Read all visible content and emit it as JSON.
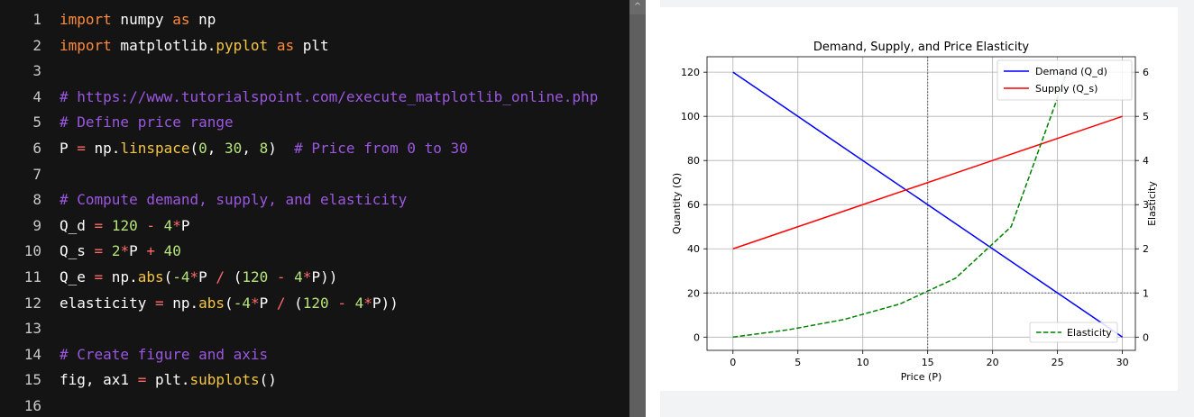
{
  "editor": {
    "lines": [
      {
        "n": "1",
        "tokens": [
          {
            "t": "import",
            "c": "tok-kw"
          },
          {
            "t": " numpy ",
            "c": "tok-id"
          },
          {
            "t": "as",
            "c": "tok-kw"
          },
          {
            "t": " np",
            "c": "tok-id"
          }
        ]
      },
      {
        "n": "2",
        "tokens": [
          {
            "t": "import",
            "c": "tok-kw"
          },
          {
            "t": " matplotlib.",
            "c": "tok-id"
          },
          {
            "t": "pyplot",
            "c": "tok-fn"
          },
          {
            "t": " ",
            "c": "tok-id"
          },
          {
            "t": "as",
            "c": "tok-kw"
          },
          {
            "t": " plt",
            "c": "tok-id"
          }
        ]
      },
      {
        "n": "3",
        "tokens": []
      },
      {
        "n": "4",
        "tokens": [
          {
            "t": "# https://www.tutorialspoint.com/execute_matplotlib_online.php",
            "c": "tok-cm"
          }
        ]
      },
      {
        "n": "5",
        "tokens": [
          {
            "t": "# Define price range",
            "c": "tok-cm"
          }
        ]
      },
      {
        "n": "6",
        "tokens": [
          {
            "t": "P ",
            "c": "tok-id"
          },
          {
            "t": "=",
            "c": "tok-op"
          },
          {
            "t": " np.",
            "c": "tok-id"
          },
          {
            "t": "linspace",
            "c": "tok-fn"
          },
          {
            "t": "(",
            "c": "tok-id"
          },
          {
            "t": "0",
            "c": "tok-num"
          },
          {
            "t": ", ",
            "c": "tok-id"
          },
          {
            "t": "30",
            "c": "tok-num"
          },
          {
            "t": ", ",
            "c": "tok-id"
          },
          {
            "t": "8",
            "c": "tok-num"
          },
          {
            "t": ")  ",
            "c": "tok-id"
          },
          {
            "t": "# Price from 0 to 30",
            "c": "tok-cm"
          }
        ]
      },
      {
        "n": "7",
        "tokens": []
      },
      {
        "n": "8",
        "tokens": [
          {
            "t": "# Compute demand, supply, and elasticity",
            "c": "tok-cm"
          }
        ]
      },
      {
        "n": "9",
        "tokens": [
          {
            "t": "Q_d ",
            "c": "tok-id"
          },
          {
            "t": "=",
            "c": "tok-op"
          },
          {
            "t": " ",
            "c": "tok-id"
          },
          {
            "t": "120",
            "c": "tok-num"
          },
          {
            "t": " ",
            "c": "tok-id"
          },
          {
            "t": "-",
            "c": "tok-op"
          },
          {
            "t": " ",
            "c": "tok-id"
          },
          {
            "t": "4",
            "c": "tok-num"
          },
          {
            "t": "*",
            "c": "tok-op"
          },
          {
            "t": "P",
            "c": "tok-id"
          }
        ]
      },
      {
        "n": "10",
        "tokens": [
          {
            "t": "Q_s ",
            "c": "tok-id"
          },
          {
            "t": "=",
            "c": "tok-op"
          },
          {
            "t": " ",
            "c": "tok-id"
          },
          {
            "t": "2",
            "c": "tok-num"
          },
          {
            "t": "*",
            "c": "tok-op"
          },
          {
            "t": "P ",
            "c": "tok-id"
          },
          {
            "t": "+",
            "c": "tok-op"
          },
          {
            "t": " ",
            "c": "tok-id"
          },
          {
            "t": "40",
            "c": "tok-num"
          }
        ]
      },
      {
        "n": "11",
        "tokens": [
          {
            "t": "Q_e ",
            "c": "tok-id"
          },
          {
            "t": "=",
            "c": "tok-op"
          },
          {
            "t": " np.",
            "c": "tok-id"
          },
          {
            "t": "abs",
            "c": "tok-fn"
          },
          {
            "t": "(",
            "c": "tok-id"
          },
          {
            "t": "-4",
            "c": "tok-num"
          },
          {
            "t": "*",
            "c": "tok-op"
          },
          {
            "t": "P ",
            "c": "tok-id"
          },
          {
            "t": "/",
            "c": "tok-op"
          },
          {
            "t": " (",
            "c": "tok-id"
          },
          {
            "t": "120",
            "c": "tok-num"
          },
          {
            "t": " ",
            "c": "tok-id"
          },
          {
            "t": "-",
            "c": "tok-op"
          },
          {
            "t": " ",
            "c": "tok-id"
          },
          {
            "t": "4",
            "c": "tok-num"
          },
          {
            "t": "*",
            "c": "tok-op"
          },
          {
            "t": "P))",
            "c": "tok-id"
          }
        ]
      },
      {
        "n": "12",
        "tokens": [
          {
            "t": "elasticity ",
            "c": "tok-id"
          },
          {
            "t": "=",
            "c": "tok-op"
          },
          {
            "t": " np.",
            "c": "tok-id"
          },
          {
            "t": "abs",
            "c": "tok-fn"
          },
          {
            "t": "(",
            "c": "tok-id"
          },
          {
            "t": "-4",
            "c": "tok-num"
          },
          {
            "t": "*",
            "c": "tok-op"
          },
          {
            "t": "P ",
            "c": "tok-id"
          },
          {
            "t": "/",
            "c": "tok-op"
          },
          {
            "t": " (",
            "c": "tok-id"
          },
          {
            "t": "120",
            "c": "tok-num"
          },
          {
            "t": " ",
            "c": "tok-id"
          },
          {
            "t": "-",
            "c": "tok-op"
          },
          {
            "t": " ",
            "c": "tok-id"
          },
          {
            "t": "4",
            "c": "tok-num"
          },
          {
            "t": "*",
            "c": "tok-op"
          },
          {
            "t": "P))",
            "c": "tok-id"
          }
        ]
      },
      {
        "n": "13",
        "tokens": []
      },
      {
        "n": "14",
        "tokens": [
          {
            "t": "# Create figure and axis",
            "c": "tok-cm"
          }
        ]
      },
      {
        "n": "15",
        "tokens": [
          {
            "t": "fig, ax1 ",
            "c": "tok-id"
          },
          {
            "t": "=",
            "c": "tok-op"
          },
          {
            "t": " plt.",
            "c": "tok-id"
          },
          {
            "t": "subplots",
            "c": "tok-fn"
          },
          {
            "t": "()",
            "c": "tok-id"
          }
        ]
      },
      {
        "n": "16",
        "tokens": []
      }
    ],
    "scroll_arrow": "^"
  },
  "chart_data": {
    "type": "line",
    "title": "Demand, Supply, and Price Elasticity",
    "xlabel": "Price (P)",
    "ylabel": "Quantity (Q)",
    "y2label": "Elasticity",
    "xlim": [
      -2,
      31
    ],
    "ylim": [
      -6,
      127
    ],
    "y2lim": [
      -0.3,
      6.35
    ],
    "xticks": [
      0,
      5,
      10,
      15,
      20,
      25,
      30
    ],
    "yticks": [
      0,
      20,
      40,
      60,
      80,
      100,
      120
    ],
    "y2ticks": [
      0,
      1,
      2,
      3,
      4,
      5,
      6
    ],
    "x": [
      0,
      4.2857,
      8.5714,
      12.8571,
      17.1429,
      21.4286,
      25.7143,
      30
    ],
    "series": [
      {
        "name": "Demand (Q_d)",
        "axis": "left",
        "color": "#0000ff",
        "style": "solid",
        "values": [
          120,
          102.857,
          85.714,
          68.571,
          51.429,
          34.286,
          17.143,
          0
        ]
      },
      {
        "name": "Supply (Q_s)",
        "axis": "left",
        "color": "#ff0000",
        "style": "solid",
        "values": [
          40,
          48.571,
          57.143,
          65.714,
          74.286,
          82.857,
          91.429,
          100
        ]
      },
      {
        "name": "Elasticity",
        "axis": "right",
        "color": "#008000",
        "style": "dashed",
        "values": [
          0,
          0.1667,
          0.4,
          0.75,
          1.3333,
          2.5,
          6.0,
          null
        ]
      }
    ],
    "reference_lines": [
      {
        "axis": "x",
        "value": 15,
        "style": "dotted",
        "color": "#555555"
      },
      {
        "axis": "y2",
        "value": 1,
        "style": "dotted",
        "color": "#555555"
      }
    ],
    "legends": [
      {
        "placement": "upper-right",
        "entries": [
          "Demand (Q_d)",
          "Supply (Q_s)"
        ]
      },
      {
        "placement": "lower-right",
        "entries": [
          "Elasticity"
        ]
      }
    ],
    "grid": true
  }
}
